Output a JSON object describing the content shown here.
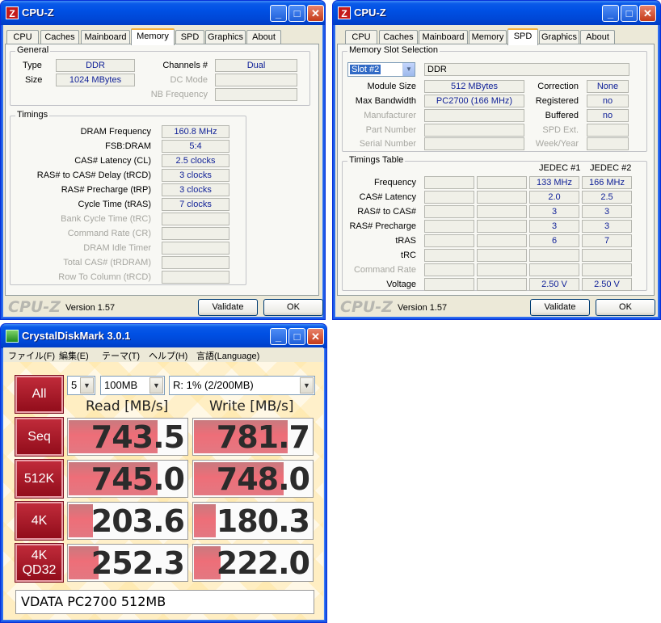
{
  "cpuz_memory": {
    "title": "CPU-Z",
    "tabs": [
      "CPU",
      "Caches",
      "Mainboard",
      "Memory",
      "SPD",
      "Graphics",
      "About"
    ],
    "active_tab": "Memory",
    "general": {
      "group_label": "General",
      "type_label": "Type",
      "type_value": "DDR",
      "size_label": "Size",
      "size_value": "1024 MBytes",
      "channels_label": "Channels #",
      "channels_value": "Dual",
      "dc_mode_label": "DC Mode",
      "dc_mode_value": "",
      "nb_freq_label": "NB Frequency",
      "nb_freq_value": ""
    },
    "timings": {
      "group_label": "Timings",
      "rows": [
        {
          "label": "DRAM Frequency",
          "value": "160.8 MHz",
          "enabled": true
        },
        {
          "label": "FSB:DRAM",
          "value": "5:4",
          "enabled": true
        },
        {
          "label": "CAS# Latency (CL)",
          "value": "2.5 clocks",
          "enabled": true
        },
        {
          "label": "RAS# to CAS# Delay (tRCD)",
          "value": "3 clocks",
          "enabled": true
        },
        {
          "label": "RAS# Precharge (tRP)",
          "value": "3 clocks",
          "enabled": true
        },
        {
          "label": "Cycle Time (tRAS)",
          "value": "7 clocks",
          "enabled": true
        },
        {
          "label": "Bank Cycle Time (tRC)",
          "value": "",
          "enabled": false
        },
        {
          "label": "Command Rate (CR)",
          "value": "",
          "enabled": false
        },
        {
          "label": "DRAM Idle Timer",
          "value": "",
          "enabled": false
        },
        {
          "label": "Total CAS# (tRDRAM)",
          "value": "",
          "enabled": false
        },
        {
          "label": "Row To Column (tRCD)",
          "value": "",
          "enabled": false
        }
      ]
    },
    "brand": "CPU-Z",
    "version": "Version 1.57",
    "validate_label": "Validate",
    "ok_label": "OK"
  },
  "cpuz_spd": {
    "title": "CPU-Z",
    "tabs": [
      "CPU",
      "Caches",
      "Mainboard",
      "Memory",
      "SPD",
      "Graphics",
      "About"
    ],
    "active_tab": "SPD",
    "slot": {
      "group_label": "Memory Slot Selection",
      "slot_value": "Slot #2",
      "type_value": "DDR",
      "module_size_label": "Module Size",
      "module_size_value": "512 MBytes",
      "max_bw_label": "Max Bandwidth",
      "max_bw_value": "PC2700 (166 MHz)",
      "manufacturer_label": "Manufacturer",
      "part_label": "Part Number",
      "serial_label": "Serial Number",
      "correction_label": "Correction",
      "correction_value": "None",
      "registered_label": "Registered",
      "registered_value": "no",
      "buffered_label": "Buffered",
      "buffered_value": "no",
      "spd_ext_label": "SPD Ext.",
      "week_year_label": "Week/Year"
    },
    "timings_table": {
      "group_label": "Timings Table",
      "headers": [
        "JEDEC #1",
        "JEDEC #2"
      ],
      "rows": [
        {
          "label": "Frequency",
          "j1": "133 MHz",
          "j2": "166 MHz",
          "enabled": true
        },
        {
          "label": "CAS# Latency",
          "j1": "2.0",
          "j2": "2.5",
          "enabled": true
        },
        {
          "label": "RAS# to CAS#",
          "j1": "3",
          "j2": "3",
          "enabled": true
        },
        {
          "label": "RAS# Precharge",
          "j1": "3",
          "j2": "3",
          "enabled": true
        },
        {
          "label": "tRAS",
          "j1": "6",
          "j2": "7",
          "enabled": true
        },
        {
          "label": "tRC",
          "j1": "",
          "j2": "",
          "enabled": true
        },
        {
          "label": "Command Rate",
          "j1": "",
          "j2": "",
          "enabled": false
        },
        {
          "label": "Voltage",
          "j1": "2.50 V",
          "j2": "2.50 V",
          "enabled": true
        }
      ]
    },
    "brand": "CPU-Z",
    "version": "Version 1.57",
    "validate_label": "Validate",
    "ok_label": "OK"
  },
  "cdm": {
    "title": "CrystalDiskMark 3.0.1",
    "menu": [
      "ファイル(F)",
      "編集(E)",
      "テーマ(T)",
      "ヘルプ(H)",
      "言語(Language)"
    ],
    "all_label": "All",
    "count_value": "5",
    "size_value": "100MB",
    "drive_value": "R: 1% (2/200MB)",
    "read_header": "Read [MB/s]",
    "write_header": "Write [MB/s]",
    "max_bar_value": 1000,
    "tests": [
      {
        "label": "Seq",
        "read": "743.5",
        "write": "781.7"
      },
      {
        "label": "512K",
        "read": "745.0",
        "write": "748.0"
      },
      {
        "label": "4K",
        "read": "203.6",
        "write": "180.3"
      },
      {
        "label": "4K\nQD32",
        "read": "252.3",
        "write": "222.0"
      }
    ],
    "comment": "VDATA PC2700 512MB",
    "colors": {
      "button_red": "#a3172a",
      "bar_red": "#e8717b"
    }
  }
}
